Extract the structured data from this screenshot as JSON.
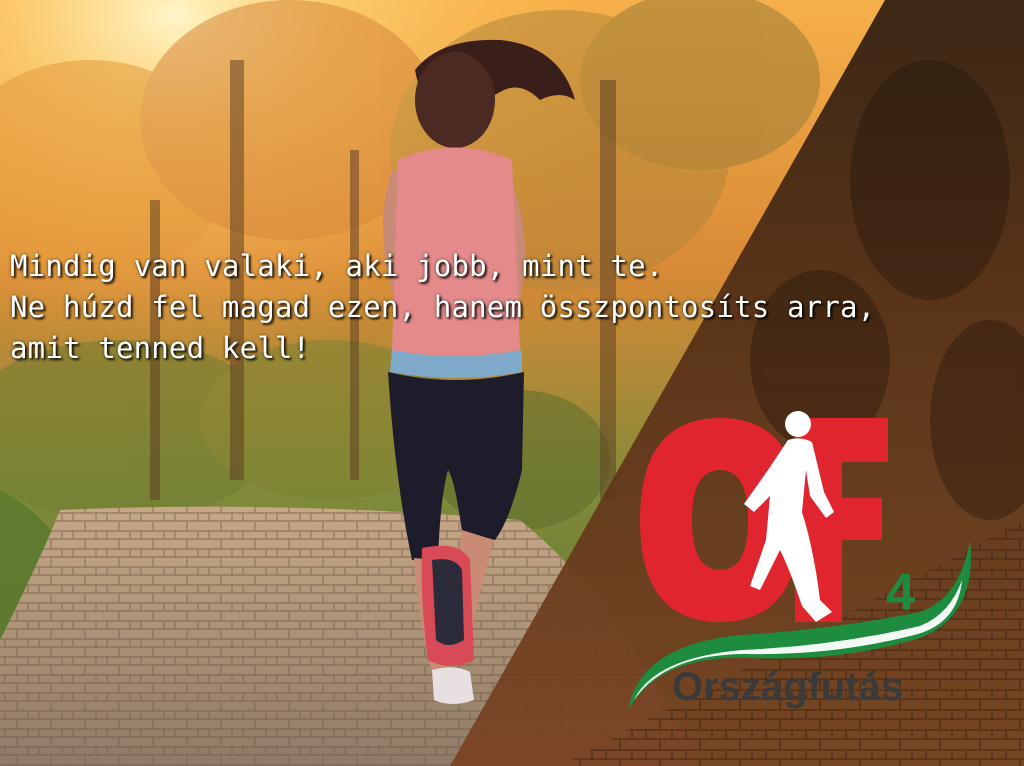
{
  "quote": {
    "line1": "Mindig van valaki, aki jobb, mint te.",
    "line2": "Ne húzd fel magad ezen, hanem összpontosíts arra,",
    "line3": "amit tenned kell!"
  },
  "logo": {
    "monogram": "OF",
    "edition": "4",
    "wordmark": "Országfutás"
  },
  "colors": {
    "logo_red": "#e1252f",
    "logo_green": "#1e8c3f",
    "wordmark": "#3a3a3a",
    "quote_text": "#ffffff"
  },
  "scene": {
    "subject": "runner-on-cobblestone-path",
    "icons": [
      "runner-silhouette-icon"
    ]
  }
}
